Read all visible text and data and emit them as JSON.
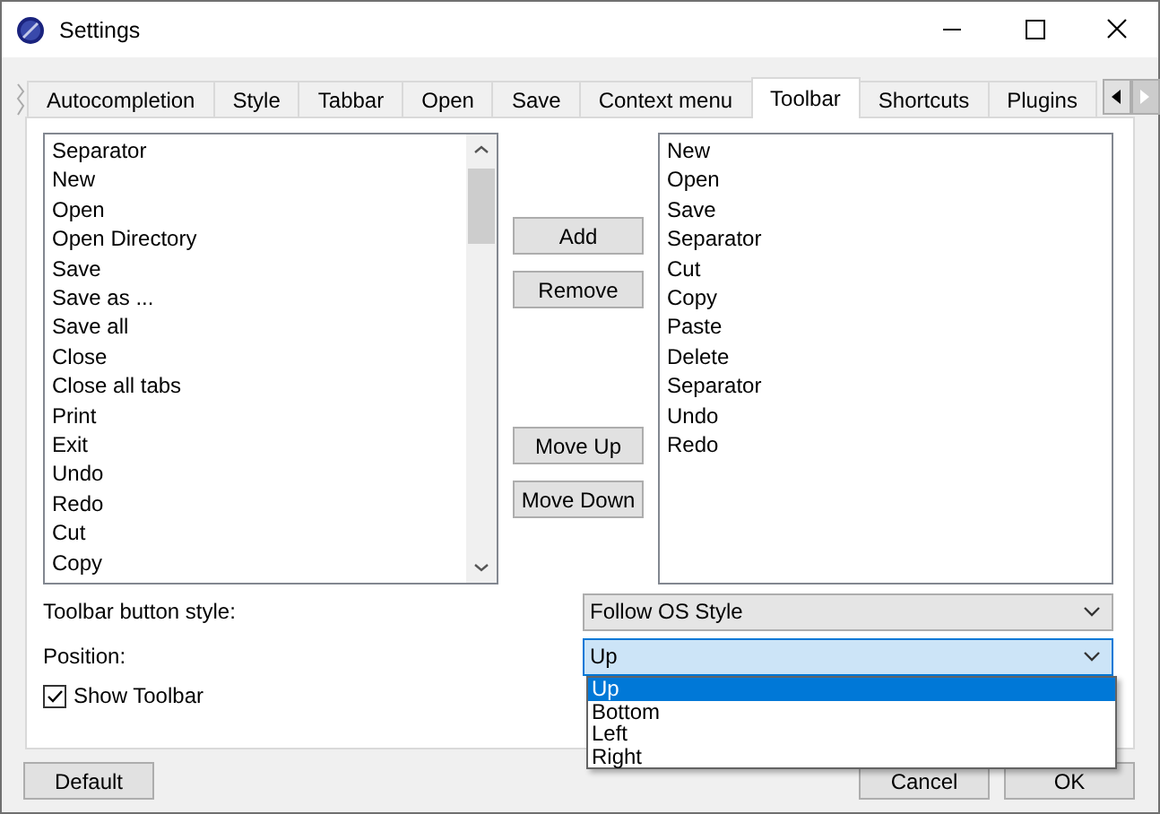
{
  "window": {
    "title": "Settings"
  },
  "tabs": [
    {
      "label": "Autocompletion",
      "selected": false
    },
    {
      "label": "Style",
      "selected": false
    },
    {
      "label": "Tabbar",
      "selected": false
    },
    {
      "label": "Open",
      "selected": false
    },
    {
      "label": "Save",
      "selected": false
    },
    {
      "label": "Context menu",
      "selected": false
    },
    {
      "label": "Toolbar",
      "selected": true
    },
    {
      "label": "Shortcuts",
      "selected": false
    },
    {
      "label": "Plugins",
      "selected": false
    }
  ],
  "available_actions": [
    "Separator",
    "New",
    "Open",
    "Open Directory",
    "Save",
    "Save as ...",
    "Save all",
    "Close",
    "Close all tabs",
    "Print",
    "Exit",
    "Undo",
    "Redo",
    "Cut",
    "Copy"
  ],
  "list_buttons": [
    "Add",
    "Remove",
    "Move Up",
    "Move Down"
  ],
  "toolbar_actions": [
    "New",
    "Open",
    "Save",
    "Separator",
    "Cut",
    "Copy",
    "Paste",
    "Delete",
    "Separator",
    "Undo",
    "Redo"
  ],
  "button_style": {
    "label": "Toolbar button style:",
    "value": "Follow OS Style"
  },
  "position": {
    "label": "Position:",
    "value": "Up",
    "expanded": true,
    "options": [
      {
        "label": "Up",
        "selected": true
      },
      {
        "label": "Bottom",
        "selected": false
      },
      {
        "label": "Left",
        "selected": false
      },
      {
        "label": "Right",
        "selected": false
      }
    ]
  },
  "show_toolbar": {
    "label": "Show Toolbar",
    "checked": true
  },
  "footer_buttons": [
    "Default",
    "Cancel",
    "OK"
  ]
}
